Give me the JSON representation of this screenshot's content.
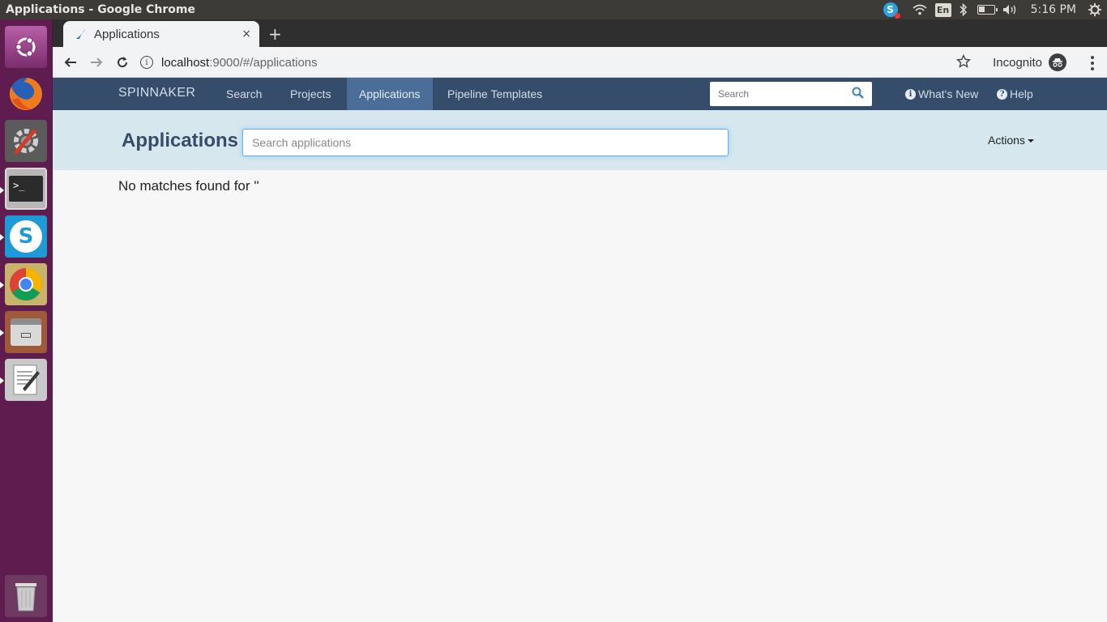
{
  "window": {
    "title": "Applications - Google Chrome"
  },
  "system_tray": {
    "input_method": "En",
    "clock": "5:16 PM"
  },
  "launcher": {
    "items": [
      "ubuntu-dash",
      "firefox",
      "system-settings",
      "terminal",
      "skype",
      "chrome",
      "files",
      "text-editor",
      "trash"
    ]
  },
  "browser": {
    "tab_title": "Applications",
    "tab_close": "×",
    "new_tab": "+",
    "url_host": "localhost",
    "url_rest": ":9000/#/applications",
    "incognito_label": "Incognito"
  },
  "spinnaker": {
    "brand": "SPINNAKER",
    "nav": [
      "Search",
      "Projects",
      "Applications",
      "Pipeline Templates"
    ],
    "active_nav": "Applications",
    "search_placeholder": "Search",
    "whats_new": "What's New",
    "help": "Help"
  },
  "applications_page": {
    "title": "Applications",
    "search_placeholder": "Search applications",
    "search_value": "",
    "actions_label": "Actions",
    "empty_message": "No matches found for ''"
  },
  "colors": {
    "header_bg": "#354d6b",
    "active_nav_bg": "#4a6e97",
    "subheader_bg": "#d6e7ee",
    "launcher_bg": "#5e1d4e"
  }
}
